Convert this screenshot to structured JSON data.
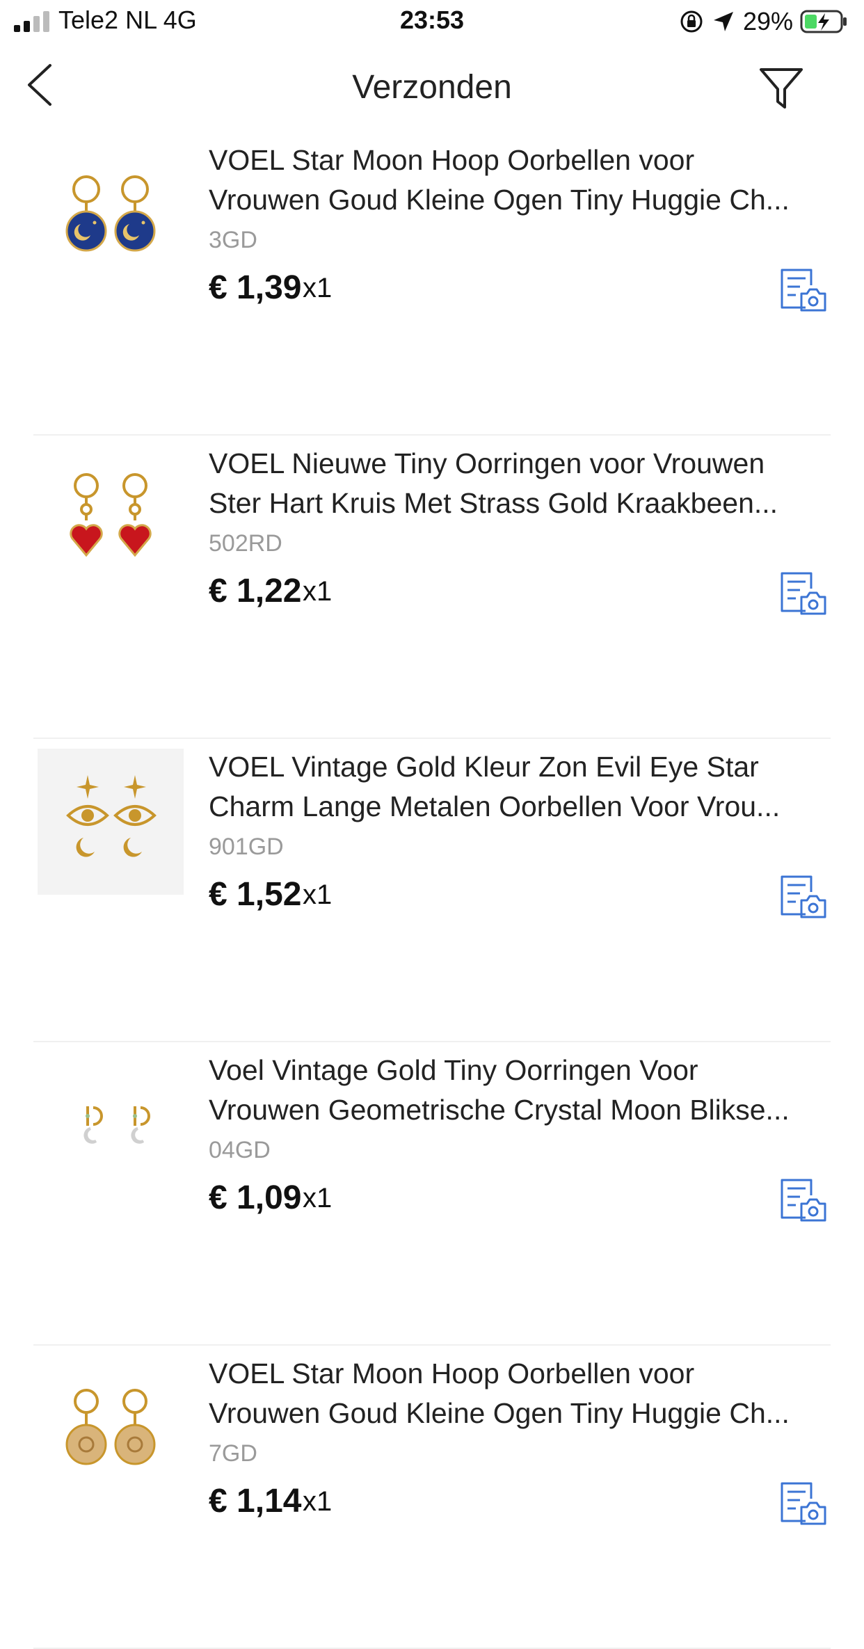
{
  "status_bar": {
    "carrier": "Tele2 NL   4G",
    "time": "23:53",
    "battery": "29%"
  },
  "nav": {
    "title": "Verzonden"
  },
  "accent_color": "#3b74d4",
  "items": [
    {
      "title_line1": "VOEL Star Moon Hoop Oorbellen voor",
      "title_line2": "Vrouwen Goud Kleine Ogen Tiny Huggie Ch...",
      "sku": "3GD",
      "price": "€ 1,39",
      "qty": "x1",
      "thumb": "blue-moon-earrings"
    },
    {
      "title_line1": "VOEL Nieuwe Tiny Oorringen voor Vrouwen",
      "title_line2": "Ster Hart Kruis Met Strass Gold Kraakbeen...",
      "sku": "502RD",
      "price": "€ 1,22",
      "qty": "x1",
      "thumb": "red-heart-earrings"
    },
    {
      "title_line1": "VOEL Vintage Gold Kleur Zon Evil Eye Star",
      "title_line2": "Charm Lange Metalen Oorbellen Voor Vrou...",
      "sku": "901GD",
      "price": "€ 1,52",
      "qty": "x1",
      "thumb": "evil-eye-earrings"
    },
    {
      "title_line1": "Voel Vintage Gold Tiny Oorringen Voor",
      "title_line2": "Vrouwen Geometrische Crystal Moon Blikse...",
      "sku": "04GD",
      "price": "€ 1,09",
      "qty": "x1",
      "thumb": "crystal-moon-earrings"
    },
    {
      "title_line1": "VOEL Star Moon Hoop Oorbellen voor",
      "title_line2": "Vrouwen Goud Kleine Ogen Tiny Huggie Ch...",
      "sku": "7GD",
      "price": "€ 1,14",
      "qty": "x1",
      "thumb": "gold-coin-earrings"
    }
  ]
}
